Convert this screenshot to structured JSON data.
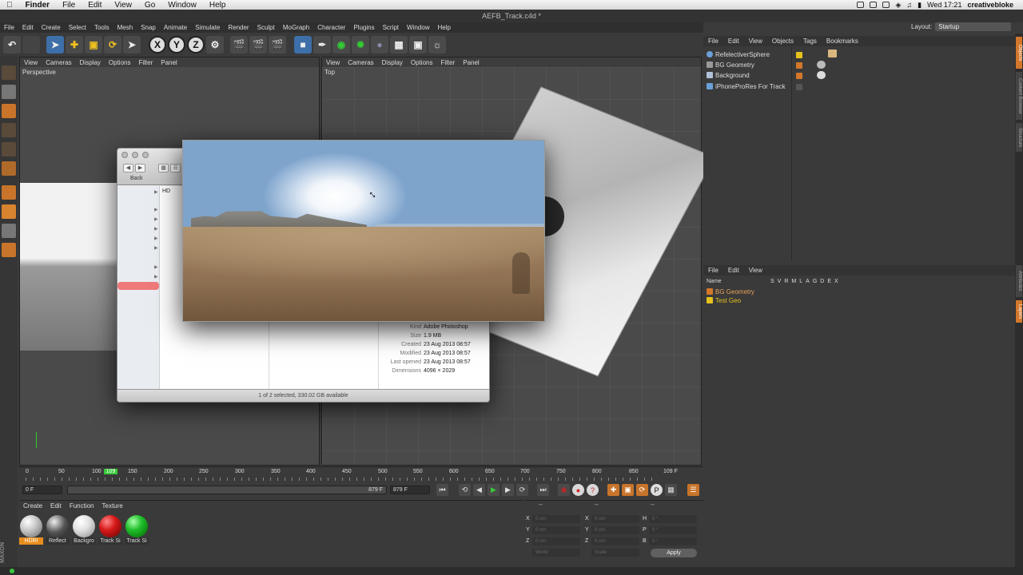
{
  "macbar": {
    "apple": "",
    "app": "Finder",
    "menus": [
      "File",
      "Edit",
      "View",
      "Go",
      "Window",
      "Help"
    ],
    "clock": "Wed 17:21",
    "user": "creativebloke"
  },
  "window_title": "AEFB_Track.c4d *",
  "c4d_menu": [
    "File",
    "Edit",
    "Create",
    "Select",
    "Tools",
    "Mesh",
    "Snap",
    "Animate",
    "Simulate",
    "Render",
    "Sculpt",
    "MoGraph",
    "Character",
    "Plugins",
    "Script",
    "Window",
    "Help"
  ],
  "layout": {
    "label": "Layout:",
    "value": "Startup"
  },
  "viewport_left": {
    "menu": [
      "View",
      "Cameras",
      "Display",
      "Options",
      "Filter",
      "Panel"
    ],
    "label": "Perspective"
  },
  "viewport_right": {
    "menu": [
      "View",
      "Cameras",
      "Display",
      "Options",
      "Filter",
      "Panel"
    ],
    "label": "Top"
  },
  "objects_panel": {
    "menu": [
      "File",
      "Edit",
      "View",
      "Objects",
      "Tags",
      "Bookmarks"
    ],
    "items": [
      "RefelectiverSphere",
      "BG Geometry",
      "Background",
      "iPhoneProRes For Track"
    ]
  },
  "layers_panel": {
    "menu": [
      "File",
      "Edit",
      "View"
    ],
    "name_header": "Name",
    "flags": [
      "S",
      "V",
      "R",
      "M",
      "L",
      "A",
      "G",
      "D",
      "E",
      "X"
    ],
    "items": [
      {
        "name": "BG Geometry",
        "color": "#d2772b"
      },
      {
        "name": "Test Geo",
        "color": "#e6c21d"
      }
    ]
  },
  "side_tabs": [
    "Objects",
    "Content Browser",
    "Structure",
    "Attributes",
    "Layers"
  ],
  "timeline": {
    "ticks": [
      "0",
      "50",
      "100",
      "109",
      "150",
      "200",
      "250",
      "300",
      "350",
      "400",
      "450",
      "500",
      "550",
      "600",
      "650",
      "700",
      "750",
      "800",
      "850"
    ],
    "current_frame": "109 F",
    "start_field": "0 F",
    "range_end_field": "879 F",
    "end_field": "879 F"
  },
  "materials": {
    "menu": [
      "Create",
      "Edit",
      "Function",
      "Texture"
    ],
    "items": [
      {
        "label": "HDRI",
        "color": "#c9c9c9"
      },
      {
        "label": "Reflect",
        "color": "#555555"
      },
      {
        "label": "Backgro",
        "color": "#e2e2e2"
      },
      {
        "label": "Track Si",
        "color": "#d61a1a"
      },
      {
        "label": "Track Si",
        "color": "#1fbe2a"
      }
    ]
  },
  "coords": {
    "header_left": "--",
    "header_mid": "--",
    "header_right": "--",
    "rows": [
      {
        "a": "X",
        "av": "0 cm",
        "b": "X",
        "bv": "0 cm",
        "c": "H",
        "cv": "0 °"
      },
      {
        "a": "Y",
        "av": "0 cm",
        "b": "Y",
        "bv": "0 cm",
        "c": "P",
        "cv": "0 °"
      },
      {
        "a": "Z",
        "av": "0 cm",
        "b": "Z",
        "bv": "0 cm",
        "c": "B",
        "cv": "0 °"
      }
    ],
    "mode": "World",
    "scale": "Scale",
    "apply": "Apply"
  },
  "finder": {
    "back": "Back",
    "hd": "HD",
    "info": [
      {
        "k": "Kind",
        "v": "Adobe Photoshop"
      },
      {
        "k": "Size",
        "v": "1.9 MB"
      },
      {
        "k": "Created",
        "v": "23 Aug 2013 08:57"
      },
      {
        "k": "Modified",
        "v": "23 Aug 2013 08:57"
      },
      {
        "k": "Last opened",
        "v": "23 Aug 2013 08:57"
      },
      {
        "k": "Dimensions",
        "v": "4096 × 2029"
      }
    ],
    "status": "1 of 2 selected, 330.02 GB available"
  },
  "colors": {
    "accent": "#e88e1e",
    "viewport": "#4a4a4a",
    "panel": "#3a3a3a"
  }
}
